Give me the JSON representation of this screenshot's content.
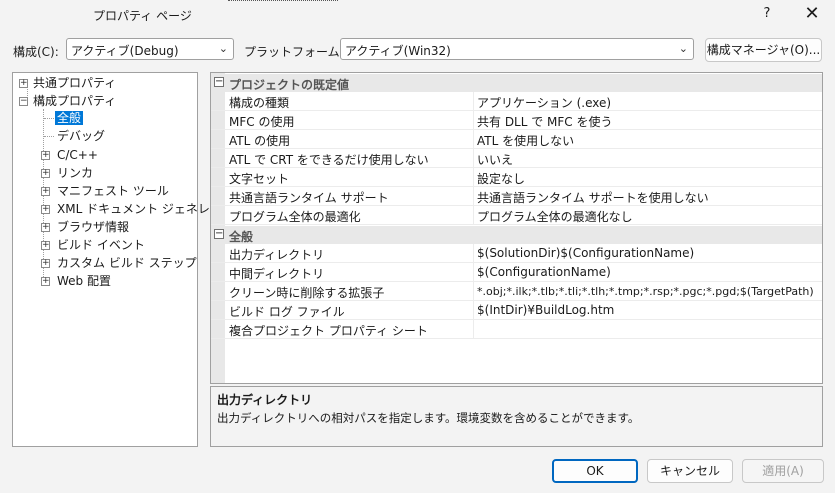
{
  "window": {
    "title": "プロパティ ページ",
    "help_label": "?",
    "close_label": "✕"
  },
  "toolbar": {
    "config_label": "構成(C):",
    "config_value": "アクティブ(Debug)",
    "platform_label": "プラットフォーム(P):",
    "platform_value": "アクティブ(Win32)",
    "config_manager_label": "構成マネージャ(O)..."
  },
  "tree": {
    "items": [
      {
        "label": "共通プロパティ",
        "expander": "+"
      },
      {
        "label": "構成プロパティ",
        "expander": "−"
      },
      {
        "label": "全般",
        "selected": true
      },
      {
        "label": "デバッグ"
      },
      {
        "label": "C/C++",
        "expander": "+"
      },
      {
        "label": "リンカ",
        "expander": "+"
      },
      {
        "label": "マニフェスト ツール",
        "expander": "+"
      },
      {
        "label": "XML ドキュメント ジェネレータ",
        "expander": "+"
      },
      {
        "label": "ブラウザ情報",
        "expander": "+"
      },
      {
        "label": "ビルド イベント",
        "expander": "+"
      },
      {
        "label": "カスタム ビルド ステップ",
        "expander": "+"
      },
      {
        "label": "Web 配置",
        "expander": "+"
      }
    ]
  },
  "grid": {
    "categories": [
      {
        "name": "プロジェクトの既定値",
        "toggle": "⊟",
        "rows": [
          {
            "name": "構成の種類",
            "value": "アプリケーション (.exe)"
          },
          {
            "name": "MFC の使用",
            "value": "共有 DLL で MFC を使う"
          },
          {
            "name": "ATL の使用",
            "value": "ATL を使用しない"
          },
          {
            "name": "ATL で CRT をできるだけ使用しない",
            "value": "いいえ"
          },
          {
            "name": "文字セット",
            "value": "設定なし"
          },
          {
            "name": "共通言語ランタイム サポート",
            "value": "共通言語ランタイム サポートを使用しない"
          },
          {
            "name": "プログラム全体の最適化",
            "value": "プログラム全体の最適化なし"
          }
        ]
      },
      {
        "name": "全般",
        "toggle": "⊟",
        "rows": [
          {
            "name": "出力ディレクトリ",
            "value": "$(SolutionDir)$(ConfigurationName)"
          },
          {
            "name": "中間ディレクトリ",
            "value": "$(ConfigurationName)"
          },
          {
            "name": "クリーン時に削除する拡張子",
            "value": "*.obj;*.ilk;*.tlb;*.tli;*.tlh;*.tmp;*.rsp;*.pgc;*.pgd;$(TargetPath)"
          },
          {
            "name": "ビルド ログ ファイル",
            "value": "$(IntDir)¥BuildLog.htm"
          },
          {
            "name": "複合プロジェクト プロパティ シート",
            "value": ""
          }
        ]
      }
    ]
  },
  "description": {
    "title": "出力ディレクトリ",
    "text": "出力ディレクトリへの相対パスを指定します。環境変数を含めることができます。"
  },
  "buttons": {
    "ok": "OK",
    "cancel": "キャンセル",
    "apply": "適用(A)"
  },
  "colors": {
    "selection": "#0078d7",
    "ok_border": "#0067c0",
    "disabled_text": "#a0a0a0"
  }
}
